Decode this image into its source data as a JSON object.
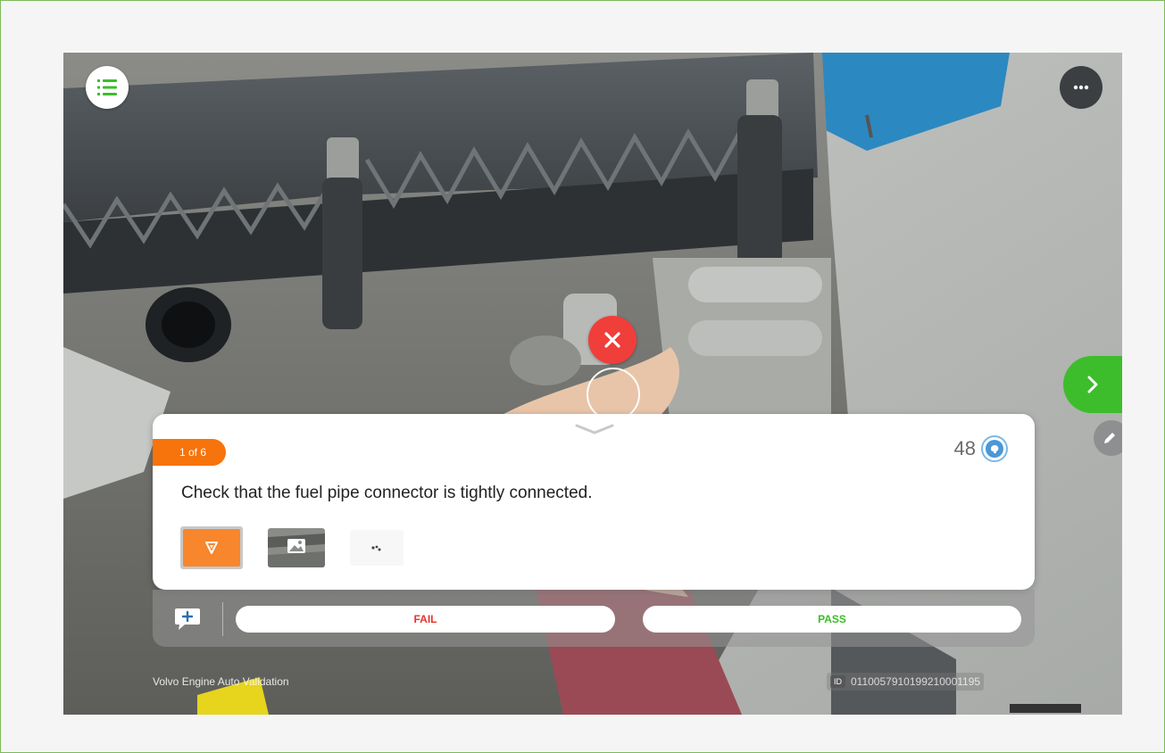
{
  "task": {
    "step_badge": "1 of 6",
    "points": "48",
    "instruction": "Check that the fuel pipe connector is tightly connected."
  },
  "actions": {
    "fail_label": "FAIL",
    "pass_label": "PASS"
  },
  "footer": {
    "app_name": "Volvo Engine Auto Validation",
    "id_label": "ID",
    "id_value": "0110057910199210001195"
  },
  "icons": {
    "menu": "list-icon",
    "more": "more-horizontal-icon",
    "next": "chevron-right-icon",
    "edit": "pencil-icon",
    "marker": "close-icon",
    "collapse": "chevron-down-icon",
    "points": "brain-icon",
    "comment": "comment-add-icon",
    "ar": "ar-marker-icon",
    "image": "image-icon"
  },
  "colors": {
    "accent_orange": "#f7730b",
    "fail_red": "#e6332f",
    "pass_green": "#3bbd2a",
    "marker_red": "#f03e3a"
  }
}
